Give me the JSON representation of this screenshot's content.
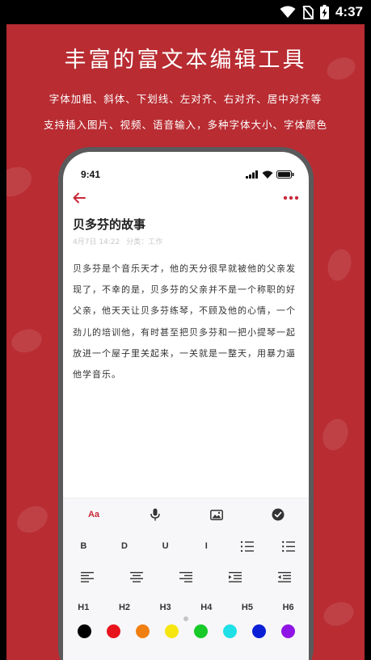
{
  "status_bar": {
    "time": "4:37"
  },
  "promo": {
    "title": "丰富的富文本编辑工具",
    "line1": "字体加粗、斜体、下划线、左对齐、右对齐、居中对齐等",
    "line2": "支持插入图片、视频、语音输入，多种字体大小、字体颜色",
    "background_color": "#b82c32"
  },
  "phone": {
    "time": "9:41",
    "note": {
      "title": "贝多芬的故事",
      "date": "4月7日 14:22",
      "category": "分类：工作",
      "body": "贝多芬是个音乐天才，他的天分很早就被他的父亲发现了，不幸的是，贝多芬的父亲并不是一个称职的好父亲，他天天让贝多芬练琴，不顾及他的心情，一个劲儿的培训他，有时甚至把贝多芬和一把小提琴一起放进一个屋子里关起来，一关就是一整天，用暴力逼他学音乐。"
    },
    "toolbar": {
      "row1": {
        "font_label": "Aa",
        "icons": [
          "microphone-icon",
          "image-icon",
          "check-circle-icon"
        ]
      },
      "row2": [
        "B",
        "D",
        "U",
        "I"
      ],
      "row2_icons": [
        "ordered-list-icon",
        "bullet-list-icon"
      ],
      "row3_icons": [
        "align-left-icon",
        "align-center-icon",
        "align-right-icon",
        "indent-increase-icon",
        "indent-decrease-icon"
      ],
      "headings": [
        "H1",
        "H2",
        "H3",
        "H4",
        "H5",
        "H6"
      ],
      "colors": [
        "#000000",
        "#e8141c",
        "#f07f12",
        "#f6e60f",
        "#18c92a",
        "#1ee0e6",
        "#0a1fd6",
        "#8f14e6"
      ]
    },
    "accent_color": "#c8283a"
  }
}
